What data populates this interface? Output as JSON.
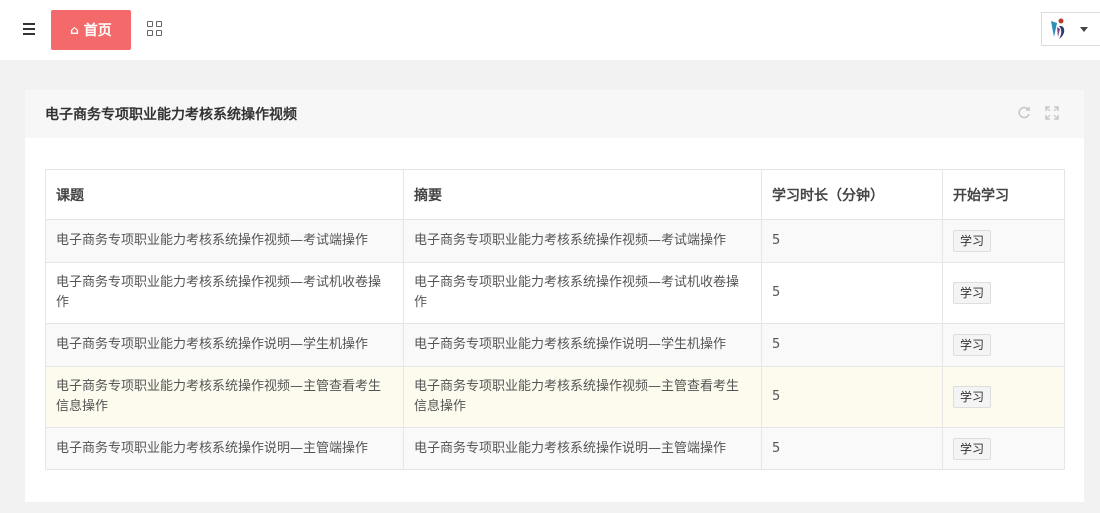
{
  "topbar": {
    "home_label": "首页"
  },
  "panel": {
    "title": "电子商务专项职业能力考核系统操作视频"
  },
  "table": {
    "headers": [
      "课题",
      "摘要",
      "学习时长（分钟）",
      "开始学习"
    ],
    "rows": [
      {
        "topic": "电子商务专项职业能力考核系统操作视频—考试端操作",
        "summary": "电子商务专项职业能力考核系统操作视频—考试端操作",
        "duration": "5",
        "action": "学习"
      },
      {
        "topic": "电子商务专项职业能力考核系统操作视频—考试机收卷操作",
        "summary": "电子商务专项职业能力考核系统操作视频—考试机收卷操作",
        "duration": "5",
        "action": "学习"
      },
      {
        "topic": "电子商务专项职业能力考核系统操作说明—学生机操作",
        "summary": "电子商务专项职业能力考核系统操作说明—学生机操作",
        "duration": "5",
        "action": "学习"
      },
      {
        "topic": "电子商务专项职业能力考核系统操作视频—主管查看考生信息操作",
        "summary": "电子商务专项职业能力考核系统操作视频—主管查看考生信息操作",
        "duration": "5",
        "action": "学习"
      },
      {
        "topic": "电子商务专项职业能力考核系统操作说明—主管端操作",
        "summary": "电子商务专项职业能力考核系统操作说明—主管端操作",
        "duration": "5",
        "action": "学习"
      }
    ]
  },
  "colors": {
    "home_tab": "#f46a6a",
    "highlight_row": "#fdfbee",
    "page_bg": "#f2f2f2"
  },
  "icons": {
    "menu": "hamburger-menu-icon",
    "home": "home-icon",
    "apps": "grid-apps-icon",
    "refresh": "refresh-icon",
    "fullscreen": "fullscreen-icon",
    "caret": "caret-down-icon"
  }
}
